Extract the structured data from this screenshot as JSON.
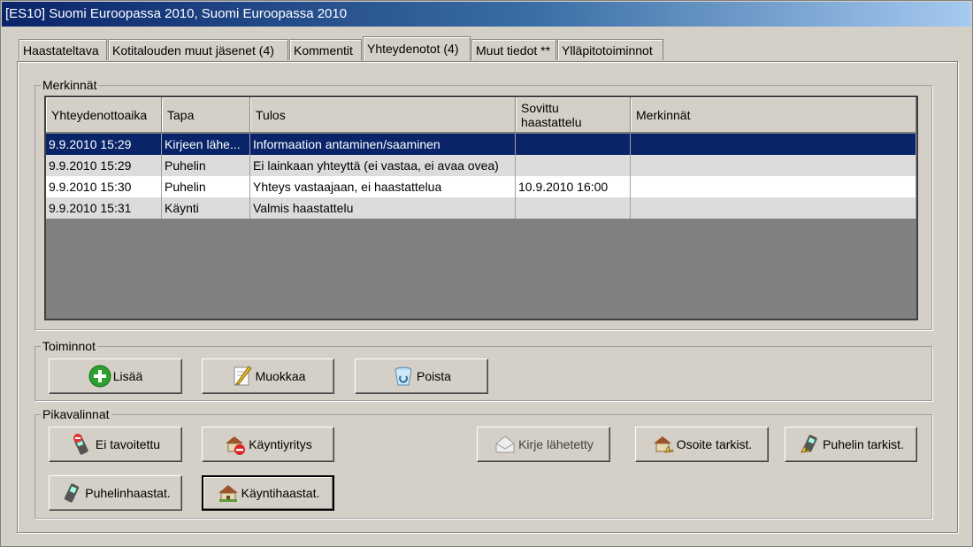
{
  "window": {
    "title": "[ES10] Suomi Euroopassa 2010, Suomi Euroopassa 2010"
  },
  "tabs": [
    {
      "label": "Haastateltava"
    },
    {
      "label": "Kotitalouden muut jäsenet (4)"
    },
    {
      "label": "Kommentit"
    },
    {
      "label": "Yhteydenotot (4)",
      "active": true
    },
    {
      "label": "Muut tiedot **"
    },
    {
      "label": "Ylläpitotoiminnot"
    }
  ],
  "merkinnat": {
    "legend": "Merkinnät",
    "columns": [
      "Yhteydenottoaika",
      "Tapa",
      "Tulos",
      "Sovittu\nhaastattelu",
      "Merkinnät"
    ],
    "rows": [
      {
        "time": "9.9.2010 15:29",
        "method": "Kirjeen lähe...",
        "result": "Informaation antaminen/saaminen",
        "appointment": "",
        "notes": "",
        "selected": true
      },
      {
        "time": "9.9.2010 15:29",
        "method": "Puhelin",
        "result": "Ei lainkaan yhteyttä (ei vastaa, ei avaa ovea)",
        "appointment": "",
        "notes": ""
      },
      {
        "time": "9.9.2010 15:30",
        "method": "Puhelin",
        "result": "Yhteys vastaajaan, ei haastattelua",
        "appointment": "10.9.2010 16:00",
        "notes": ""
      },
      {
        "time": "9.9.2010 15:31",
        "method": "Käynti",
        "result": "Valmis haastattelu",
        "appointment": "",
        "notes": ""
      }
    ]
  },
  "toiminnot": {
    "legend": "Toiminnot",
    "add_label": "Lisää",
    "edit_label": "Muokkaa",
    "delete_label": "Poista"
  },
  "pikavalinnat": {
    "legend": "Pikavalinnat",
    "not_reached_label": "Ei tavoitettu",
    "visit_attempt_label": "Käyntiyritys",
    "letter_sent_label": "Kirje lähetetty",
    "address_check_label": "Osoite tarkist.",
    "phone_check_label": "Puhelin tarkist.",
    "phone_interview_label": "Puhelinhaastat.",
    "visit_interview_label": "Käyntihaastat."
  },
  "colors": {
    "selection": "#0a246a",
    "face": "#d4d0c8",
    "grid_empty": "#808080"
  }
}
